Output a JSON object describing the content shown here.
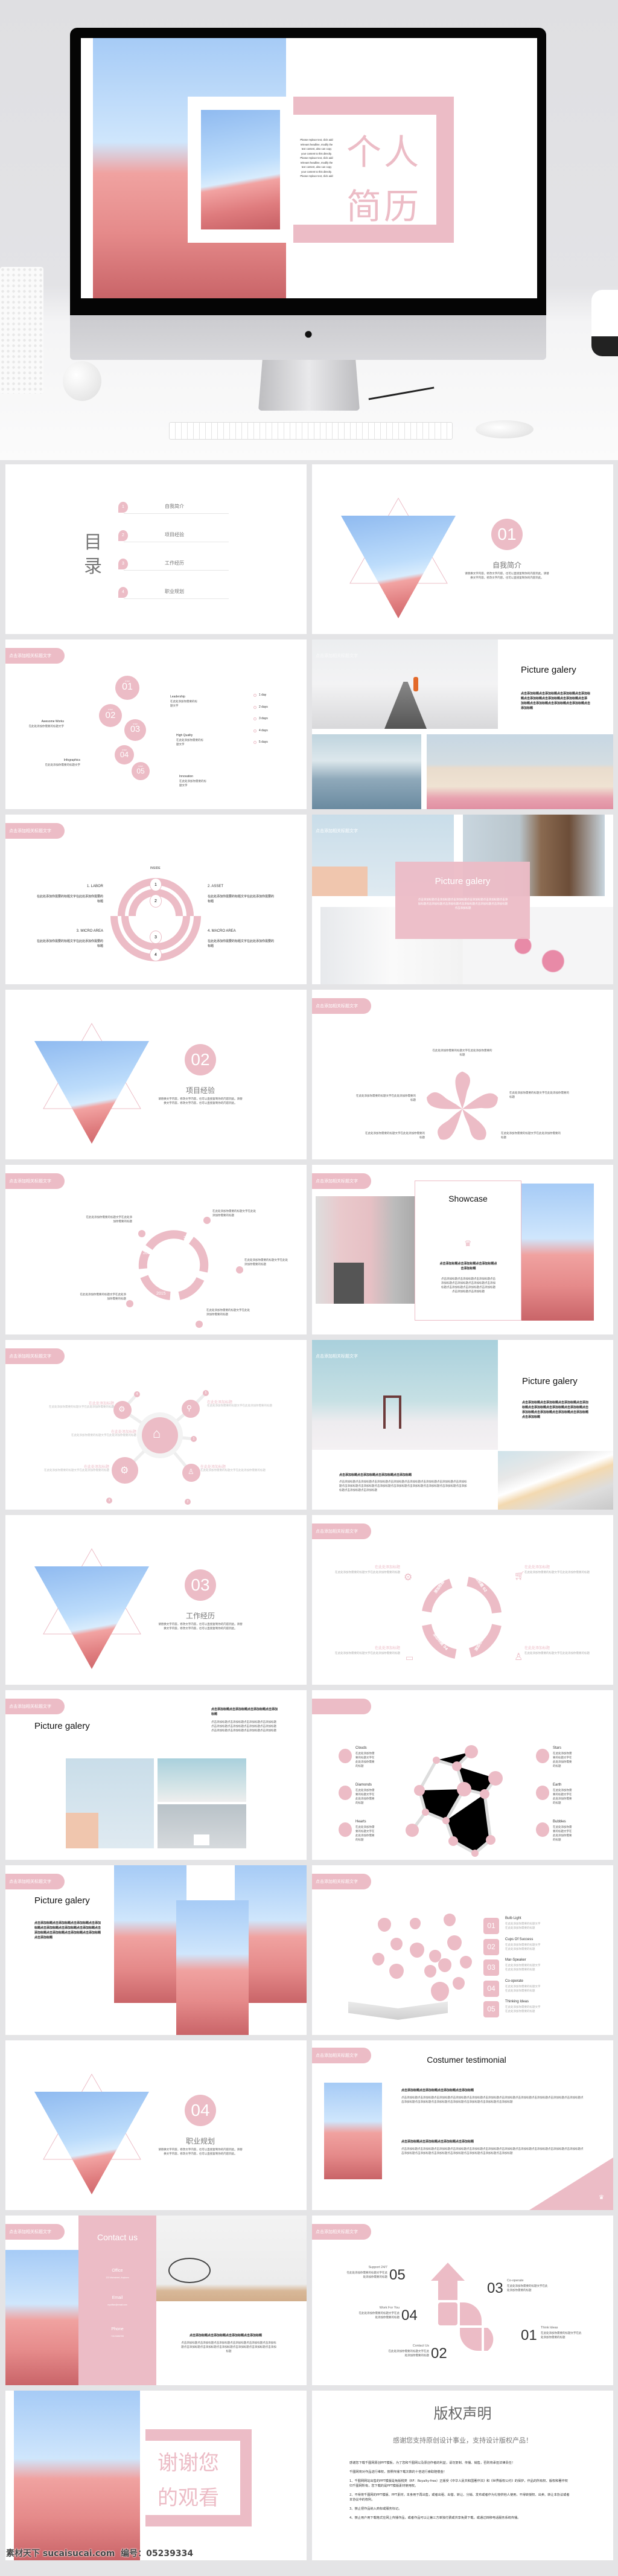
{
  "colors": {
    "accent": "#ecbcc6",
    "background": "#e4e4e6",
    "text": "#555555"
  },
  "hero": {
    "title_line1": "个人",
    "title_line2": "简历",
    "blurb": "Please replace text, click add relevant headline, modify the text content, also can copy your content to this directly. Please replace text, click add relevant headline, modify the text content, also can copy your content to this directly. Please replace text, click add",
    "logo_icon": "apple-logo-icon"
  },
  "common": {
    "header_pill": "点击添加相关标题文字",
    "placeholder": "在此处添加你需要的标题文字在此处添加你需要的标题",
    "filler": "点击添加标题点击添加标题点击添加标题点击添加标题点击添加标题点击添加标题",
    "filler_bold": "点击添加标题点击添加标题点击添加标题点击添加标题",
    "section_desc": "请替换文字内容，修改文字内容，也可以直接复制你的内容到此。请替换文字内容，修改文字内容，也可以直接复制你的内容到此。",
    "add_heading": "在此处添加标题"
  },
  "toc": {
    "title": "目录",
    "items": [
      {
        "num": "1",
        "label": "自我简介"
      },
      {
        "num": "2",
        "label": "项目经验"
      },
      {
        "num": "3",
        "label": "工作经历"
      },
      {
        "num": "4",
        "label": "职业规划"
      }
    ]
  },
  "sections": [
    {
      "num": "01",
      "title": "自我简介"
    },
    {
      "num": "02",
      "title": "项目经验"
    },
    {
      "num": "03",
      "title": "工作经历"
    },
    {
      "num": "04",
      "title": "职业规划"
    }
  ],
  "steps": {
    "step_label": "STEP",
    "nums": [
      "01",
      "02",
      "03",
      "04",
      "05"
    ],
    "left": [
      {
        "title": "Awesome Works",
        "text": "在此处添加你需要的标题文字"
      },
      {
        "title": "Infographics",
        "text": "在此处添加你需要的标题文字"
      }
    ],
    "right": [
      {
        "title": "Leadership",
        "text": "在此处添加你需要的标题文字"
      },
      {
        "title": "High Quality",
        "text": "在此处添加你需要的标题文字"
      },
      {
        "title": "Innovation",
        "text": "在此处添加你需要的标题文字"
      }
    ],
    "days": [
      "1 day",
      "2 days",
      "3 days",
      "4 days",
      "5 days"
    ]
  },
  "rings": {
    "top": "INSIDE",
    "nums": [
      "1",
      "2",
      "3",
      "4"
    ],
    "quadrants": [
      "1. LABOR",
      "2. ASSET",
      "3. MICRO AREA",
      "4. MACRO AREA"
    ]
  },
  "gallery_title": "Picture galery",
  "showcase": {
    "title": "Showcase"
  },
  "years": [
    "2012",
    "2013",
    "2014",
    "2015",
    "2016"
  ],
  "mindmap": {
    "nums": [
      "1",
      "2",
      "3",
      "4",
      "5"
    ]
  },
  "cycle": {
    "labels": [
      "添加标题 01",
      "添加标题 02",
      "添加标题 03",
      "添加标题 04"
    ]
  },
  "molecule": {
    "left": [
      "Clouds",
      "Diamonds",
      "Hearts"
    ],
    "right": [
      "Stars",
      "Earth",
      "Bubbles"
    ]
  },
  "book": {
    "items": [
      {
        "num": "01",
        "title": "Bulb Light"
      },
      {
        "num": "02",
        "title": "Cups Of Success"
      },
      {
        "num": "03",
        "title": "Mar-Speaker"
      },
      {
        "num": "04",
        "title": "Co-operate"
      },
      {
        "num": "05",
        "title": "Thinking Ideas"
      }
    ]
  },
  "testimonial": {
    "title": "Costumer testimonial"
  },
  "contact": {
    "title": "Contact us",
    "office_label": "Office",
    "office": "123 Mainstreet, Anytown",
    "email_label": "Email",
    "email": "myoffice@email.com",
    "phone_label": "Phone",
    "phone": "+0123456789"
  },
  "arrow_steps": [
    {
      "num": "05",
      "title": "Support 24/7"
    },
    {
      "num": "04",
      "title": "Work For You"
    },
    {
      "num": "02",
      "title": "Contact Us"
    },
    {
      "num": "03",
      "title": "Co-operate"
    },
    {
      "num": "01",
      "title": "Think Ideas"
    }
  ],
  "thanks": {
    "line1": "谢谢您",
    "line2": "的观看"
  },
  "copyright": {
    "title": "版权声明",
    "subtitle": "感谢您支持原创设计事业，支持设计版权产品！",
    "paragraphs": [
      "感谢您下载千图网原创PPT模板，为了您和千图网以及原创作者的利益，请勿复制、传播、销售，否则将承担法律责任！",
      "千图网将对作品进行维权，按照传播下载次数的十倍进行索取赔偿金！",
      "1、千图网网站出售的PPT模版是免版税类（RF：Royalty-free）正版受《中华人民共和国著作法》和《世界版权公约》的保护，作品的所有权、版权和著作权归千图网所有，您下载的是PPT模版素材使用权。",
      "2、不得将千图网的PPT模版、PPT素材，本身用于再出售，或者出租、出借、转让、分销、发布或者作为礼物供他人使用，不得转授权、出卖、转让本协议或者本协议中的权利。",
      "3、禁止把作品纳入商标或服务标记。",
      "4、禁止用户用下载格式在网上传播作品，或者作品可以让第三方单独付费或共享免费下载，或通过转移电话服务系统传播。"
    ]
  },
  "watermark": "素材天下 sucaisucai.com  编号：05239334"
}
